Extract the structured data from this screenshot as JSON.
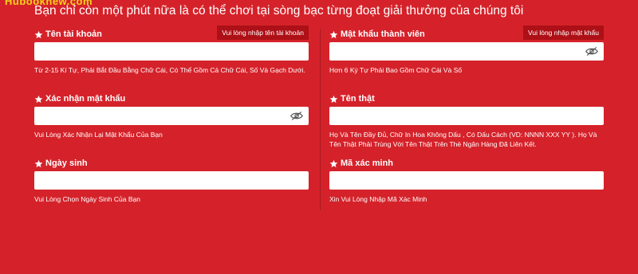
{
  "brand": {
    "text": "Hubooknew.com"
  },
  "headline": "Bạn chỉ còn một phút nữa là có thể chơi tại sòng bạc từng đoạt giải thưởng của chúng tôi",
  "fields": {
    "username": {
      "label": "Tên tài khoản",
      "value": "",
      "error": "Vui lòng nhập tên tài khoản",
      "hint": "Từ 2-15 Kí Tự, Phải Bắt Đầu Bằng Chữ Cái, Có Thể Gồm Cả Chữ Cái, Số Và Gạch Dưới."
    },
    "password": {
      "label": "Mật khẩu thành viên",
      "value": "",
      "error": "Vui lòng nhập mật khẩu",
      "hint": "Hơn 6 Ký Tự Phải Bao Gồm Chữ Cái Và Số",
      "icon": "eye-slash-icon"
    },
    "confirm_password": {
      "label": "Xác nhận mật khẩu",
      "value": "",
      "hint": "Vui Lòng Xác Nhận Lại Mật Khẩu Của Bạn",
      "icon": "eye-slash-icon"
    },
    "real_name": {
      "label": "Tên thật",
      "value": "",
      "hint": "Họ Và Tên Đầy Đủ, Chữ In Hoa Không Dấu , Có Dấu Cách (VD: NNNN XXX YY ). Họ Và Tên Thật Phải Trùng Với Tên Thật Trên Thẻ Ngân Hàng Đã Liên Kết."
    },
    "birthday": {
      "label": "Ngày sinh",
      "value": "",
      "hint": "Vui Lòng Chọn Ngày Sinh Của Bạn"
    },
    "verify_code": {
      "label": "Mã xác minh",
      "value": "",
      "hint": "Xin Vui Lòng Nhập Mã Xác Minh"
    }
  },
  "colors": {
    "background": "#d5222a",
    "error_badge": "#ad1016",
    "brand": "#f5d21a"
  }
}
